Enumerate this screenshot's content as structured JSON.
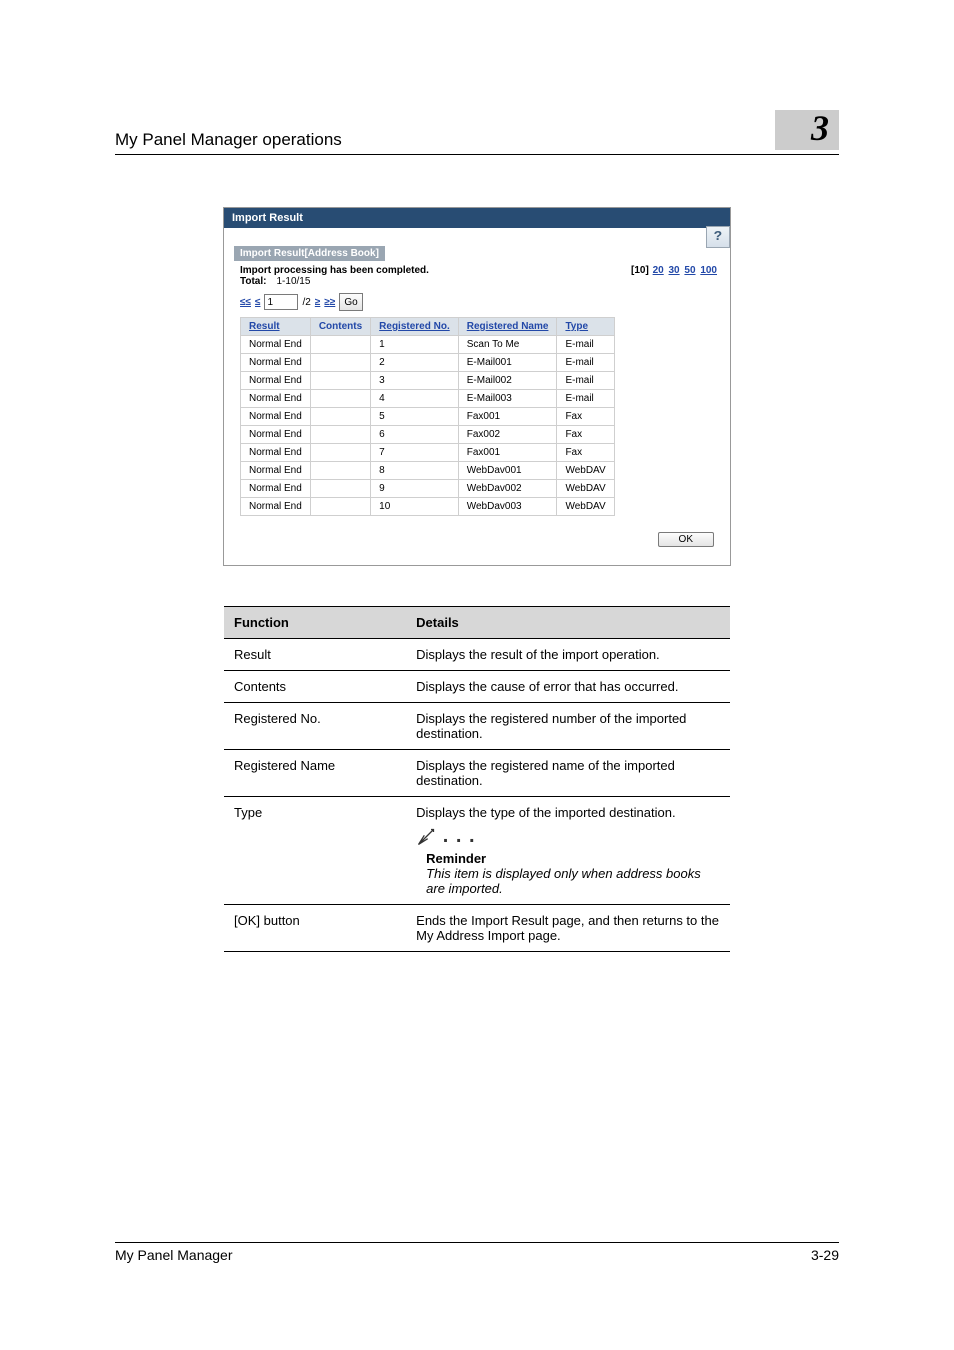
{
  "header": {
    "title": "My Panel Manager operations",
    "chapter": "3"
  },
  "import_result": {
    "panel_title": "Import Result",
    "help_glyph": "?",
    "sub_bar": "Import Result[Address Book]",
    "message": "Import processing has been completed.",
    "total_label": "Total:",
    "total_range": "1-10/15",
    "page_sizes_prefix": "[10]",
    "page_sizes": [
      "20",
      "30",
      "50",
      "100"
    ],
    "pager": {
      "first": "≤≤",
      "prev": "≤",
      "page_value": "1",
      "of": "/2",
      "next": "≥",
      "last": "≥≥",
      "go": "Go"
    },
    "columns": [
      "Result",
      "Contents",
      "Registered No.",
      "Registered Name",
      "Type"
    ],
    "rows": [
      {
        "result": "Normal End",
        "contents": "",
        "no": "1",
        "name": "Scan To Me",
        "type": "E-mail"
      },
      {
        "result": "Normal End",
        "contents": "",
        "no": "2",
        "name": "E-Mail001",
        "type": "E-mail"
      },
      {
        "result": "Normal End",
        "contents": "",
        "no": "3",
        "name": "E-Mail002",
        "type": "E-mail"
      },
      {
        "result": "Normal End",
        "contents": "",
        "no": "4",
        "name": "E-Mail003",
        "type": "E-mail"
      },
      {
        "result": "Normal End",
        "contents": "",
        "no": "5",
        "name": "Fax001",
        "type": "Fax"
      },
      {
        "result": "Normal End",
        "contents": "",
        "no": "6",
        "name": "Fax002",
        "type": "Fax"
      },
      {
        "result": "Normal End",
        "contents": "",
        "no": "7",
        "name": "Fax001",
        "type": "Fax"
      },
      {
        "result": "Normal End",
        "contents": "",
        "no": "8",
        "name": "WebDav001",
        "type": "WebDAV"
      },
      {
        "result": "Normal End",
        "contents": "",
        "no": "9",
        "name": "WebDav002",
        "type": "WebDAV"
      },
      {
        "result": "Normal End",
        "contents": "",
        "no": "10",
        "name": "WebDav003",
        "type": "WebDAV"
      }
    ],
    "ok": "OK"
  },
  "desc_table": {
    "head": [
      "Function",
      "Details"
    ],
    "rows": [
      {
        "f": "Result",
        "d": "Displays the result of the import operation."
      },
      {
        "f": "Contents",
        "d": "Displays the cause of error that has occurred."
      },
      {
        "f": "Registered No.",
        "d": "Displays the registered number of the imported destination."
      },
      {
        "f": "Registered Name",
        "d": "Displays the registered name of the imported destination."
      },
      {
        "f": "Type",
        "d": "Displays the type of the imported destination.",
        "reminder": {
          "title": "Reminder",
          "text": "This item is displayed only when address books are imported."
        }
      },
      {
        "f": "[OK] button",
        "d": "Ends the Import Result page, and then returns to the My Address Import page."
      }
    ]
  },
  "footer": {
    "left": "My Panel Manager",
    "right": "3-29"
  }
}
